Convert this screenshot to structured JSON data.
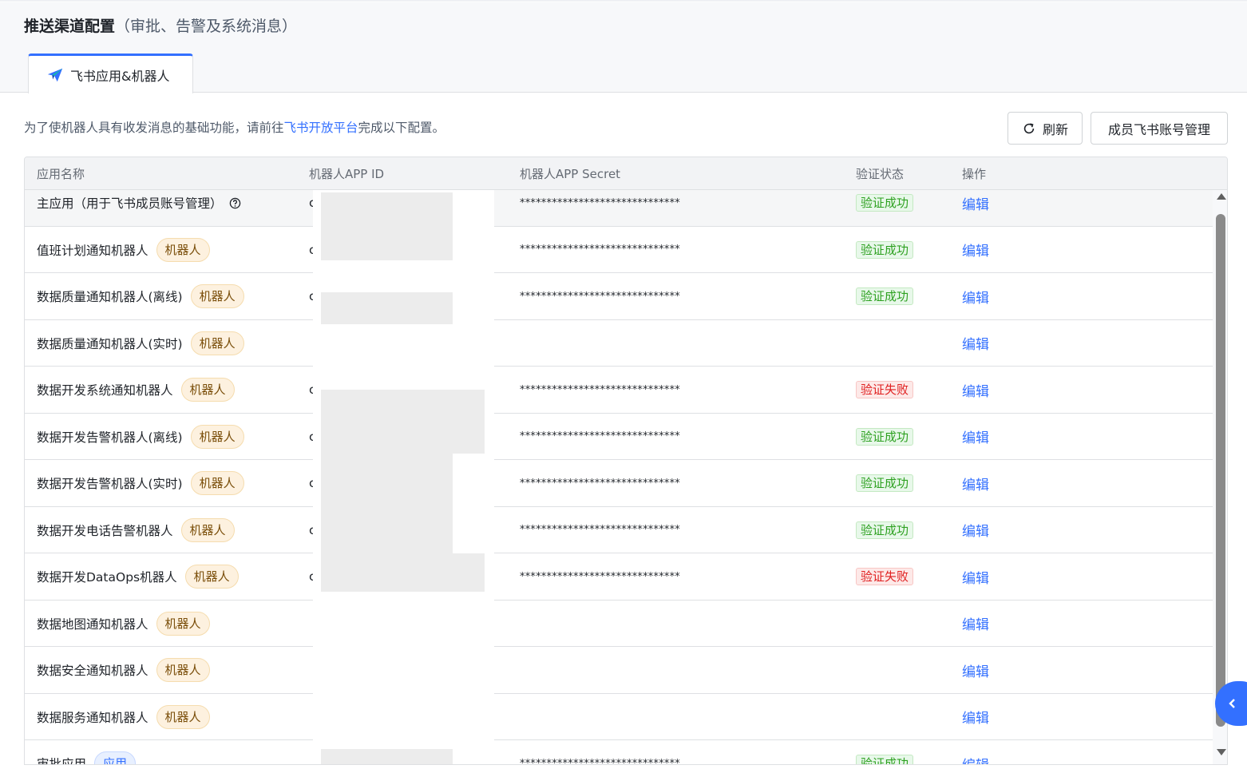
{
  "header": {
    "title": "推送渠道配置",
    "subtitle": "（审批、告警及系统消息）"
  },
  "tabs": [
    {
      "label": "飞书应用&机器人",
      "icon": "paper-plane-icon",
      "active": true
    }
  ],
  "intro": {
    "prefix": "为了使机器人具有收发消息的基础功能，请前往",
    "link": "飞书开放平台",
    "suffix": "完成以下配置。"
  },
  "toolbar": {
    "refresh_label": "刷新",
    "refresh_icon": "refresh-icon",
    "members_label": "成员飞书账号管理"
  },
  "table": {
    "columns": [
      "应用名称",
      "机器人APP ID",
      "机器人APP Secret",
      "验证状态",
      "操作"
    ],
    "rows": [
      {
        "name": "主应用（用于飞书成员账号管理）",
        "tag": "",
        "help": true,
        "app_id": "c",
        "secret": "******************************",
        "status": "验证成功",
        "op": "编辑"
      },
      {
        "name": "值班计划通知机器人",
        "tag": "机器人",
        "app_id": "c",
        "secret": "******************************",
        "status": "验证成功",
        "op": "编辑"
      },
      {
        "name": "数据质量通知机器人(离线)",
        "tag": "机器人",
        "app_id": "c",
        "secret": "******************************",
        "status": "验证成功",
        "op": "编辑"
      },
      {
        "name": "数据质量通知机器人(实时)",
        "tag": "机器人",
        "app_id": "",
        "secret": "",
        "status": "",
        "op": "编辑"
      },
      {
        "name": "数据开发系统通知机器人",
        "tag": "机器人",
        "app_id": "c",
        "secret": "******************************",
        "status": "验证失败",
        "op": "编辑"
      },
      {
        "name": "数据开发告警机器人(离线)",
        "tag": "机器人",
        "app_id": "c",
        "secret": "******************************",
        "status": "验证成功",
        "op": "编辑"
      },
      {
        "name": "数据开发告警机器人(实时)",
        "tag": "机器人",
        "app_id": "c",
        "secret": "******************************",
        "status": "验证成功",
        "op": "编辑"
      },
      {
        "name": "数据开发电话告警机器人",
        "tag": "机器人",
        "app_id": "c",
        "secret": "******************************",
        "status": "验证成功",
        "op": "编辑"
      },
      {
        "name": "数据开发DataOps机器人",
        "tag": "机器人",
        "app_id": "c",
        "secret": "******************************",
        "status": "验证失败",
        "op": "编辑"
      },
      {
        "name": "数据地图通知机器人",
        "tag": "机器人",
        "app_id": "",
        "secret": "",
        "status": "",
        "op": "编辑"
      },
      {
        "name": "数据安全通知机器人",
        "tag": "机器人",
        "app_id": "",
        "secret": "",
        "status": "",
        "op": "编辑"
      },
      {
        "name": "数据服务通知机器人",
        "tag": "机器人",
        "app_id": "",
        "secret": "",
        "status": "",
        "op": "编辑"
      },
      {
        "name": "审批应用",
        "tag": "应用",
        "tag_type": "app",
        "app_id": "",
        "secret": "******************************",
        "status": "验证成功",
        "op": "编辑"
      }
    ]
  },
  "colors": {
    "accent": "#3370ff",
    "success": "#2ea121",
    "fail": "#e02020",
    "tag_bg": "#fdf1df"
  },
  "float_button": {
    "icon": "chevron-left-icon"
  }
}
